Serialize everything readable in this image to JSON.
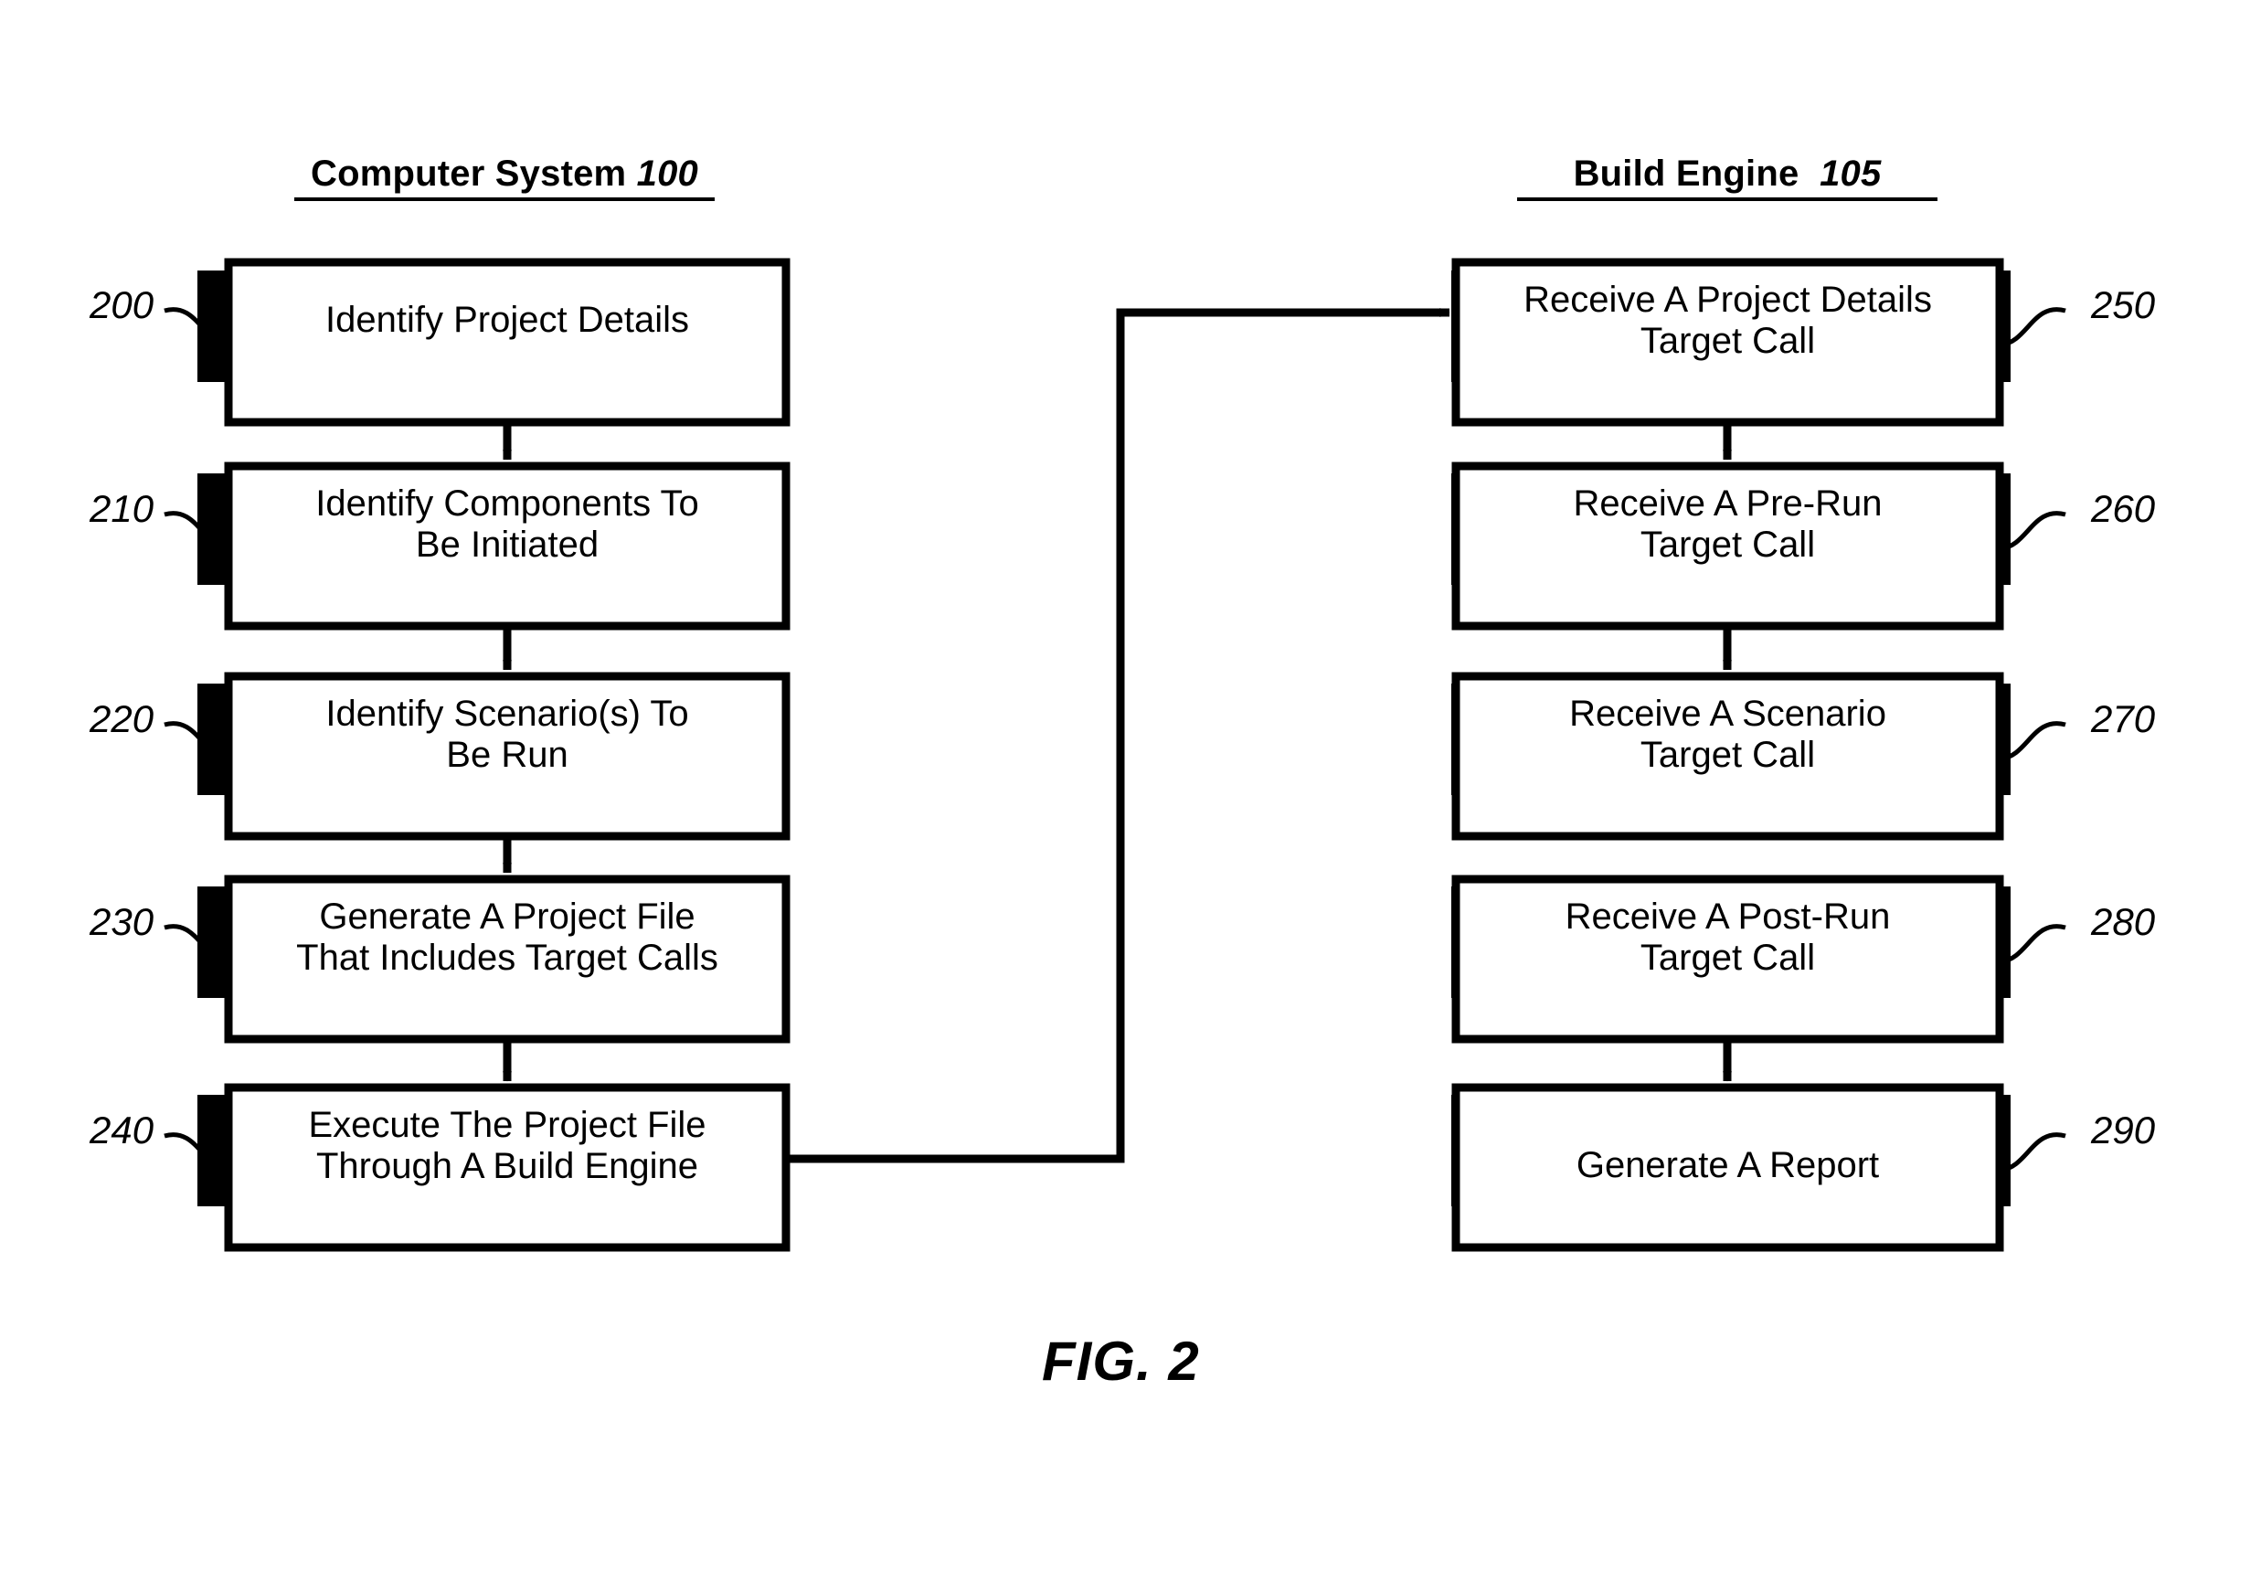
{
  "figure": {
    "caption": "FIG. 2",
    "columns": [
      {
        "id": "computer-system",
        "title": "Computer System",
        "number": "100"
      },
      {
        "id": "build-engine",
        "title": "Build Engine",
        "number": "105"
      }
    ]
  },
  "left_column": {
    "title": "Computer System",
    "number": "100",
    "steps": [
      {
        "ref": "200",
        "label": "Identify Project Details"
      },
      {
        "ref": "210",
        "label": "Identify Components To\nBe Initiated"
      },
      {
        "ref": "220",
        "label": "Identify Scenario(s) To\nBe Run"
      },
      {
        "ref": "230",
        "label": "Generate A Project File\nThat Includes Target Calls"
      },
      {
        "ref": "240",
        "label": "Execute The Project File\nThrough A Build Engine"
      }
    ]
  },
  "right_column": {
    "title": "Build Engine",
    "number": "105",
    "steps": [
      {
        "ref": "250",
        "label": "Receive A Project Details\nTarget Call"
      },
      {
        "ref": "260",
        "label": "Receive A Pre-Run\nTarget Call"
      },
      {
        "ref": "270",
        "label": "Receive A Scenario\nTarget Call"
      },
      {
        "ref": "280",
        "label": "Receive A Post-Run\nTarget Call"
      },
      {
        "ref": "290",
        "label": "Generate A Report"
      }
    ]
  },
  "colors": {
    "ink": "#000000",
    "paper": "#ffffff"
  }
}
